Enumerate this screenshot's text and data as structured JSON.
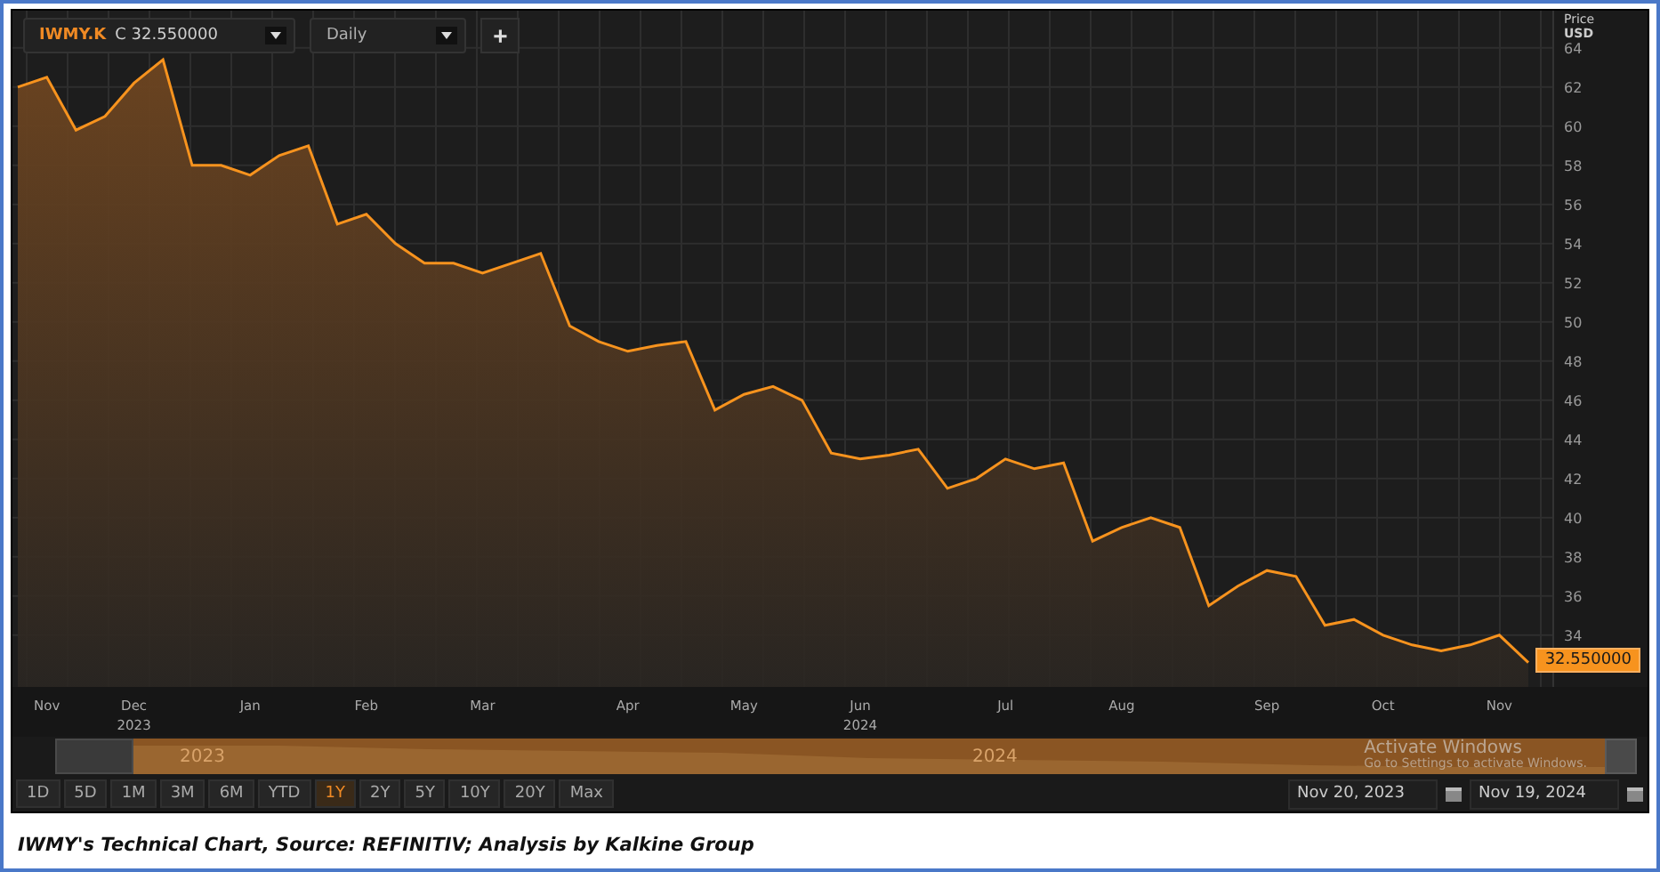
{
  "toolbar": {
    "symbol": "IWMY.K",
    "quote": "C 32.550000",
    "interval": "Daily",
    "add_button": "+"
  },
  "chart": {
    "axis_unit": "USD",
    "chart_data": {
      "type": "area",
      "ylabel": "Price",
      "categories": [
        null,
        "Nov",
        null,
        null,
        "Dec",
        null,
        null,
        null,
        "Jan",
        null,
        null,
        null,
        "Feb",
        null,
        null,
        null,
        "Mar",
        null,
        null,
        null,
        null,
        "Apr",
        null,
        null,
        null,
        "May",
        null,
        null,
        null,
        "Jun",
        null,
        null,
        null,
        null,
        "Jul",
        null,
        null,
        null,
        "Aug",
        null,
        null,
        null,
        null,
        "Sep",
        null,
        null,
        null,
        "Oct",
        null,
        null,
        null,
        "Nov",
        null
      ],
      "series": [
        {
          "color": "#f7931e",
          "values": [
            62.0,
            62.5,
            59.8,
            60.5,
            62.2,
            63.4,
            58.0,
            58.0,
            57.5,
            58.5,
            59.0,
            55.0,
            55.5,
            54.0,
            53.0,
            53.0,
            52.5,
            53.0,
            53.5,
            49.8,
            49.0,
            48.5,
            48.8,
            49.0,
            45.5,
            46.3,
            46.7,
            46.0,
            43.3,
            43.0,
            43.2,
            43.5,
            41.5,
            42.0,
            43.0,
            42.5,
            42.8,
            38.8,
            39.5,
            40.0,
            39.5,
            35.5,
            36.5,
            37.3,
            37.0,
            34.5,
            34.8,
            34.0,
            33.5,
            33.2,
            33.5,
            34.0,
            32.6
          ]
        }
      ],
      "ylim": [
        31.35,
        65.9
      ],
      "grid": true,
      "annotations": [
        "2023",
        "2024"
      ],
      "yticks": [
        34,
        36,
        38,
        40,
        42,
        44,
        46,
        48,
        50,
        52,
        54,
        56,
        58,
        60,
        62,
        64
      ]
    },
    "last_value_label": "32.550000"
  },
  "navigator": {
    "year_labels": [
      "2023",
      "2024"
    ]
  },
  "range_buttons": [
    {
      "label": "1D",
      "selected": false
    },
    {
      "label": "5D",
      "selected": false
    },
    {
      "label": "1M",
      "selected": false
    },
    {
      "label": "3M",
      "selected": false
    },
    {
      "label": "6M",
      "selected": false
    },
    {
      "label": "YTD",
      "selected": false
    },
    {
      "label": "1Y",
      "selected": true
    },
    {
      "label": "2Y",
      "selected": false
    },
    {
      "label": "5Y",
      "selected": false
    },
    {
      "label": "10Y",
      "selected": false
    },
    {
      "label": "20Y",
      "selected": false
    },
    {
      "label": "Max",
      "selected": false
    }
  ],
  "date_range": {
    "from": "Nov 20, 2023",
    "to": "Nov 19, 2024"
  },
  "os_notice": {
    "title": "Activate Windows",
    "text": "Go to Settings to activate Windows."
  },
  "caption": "IWMY's Technical Chart, Source: REFINITIV; Analysis by Kalkine Group"
}
